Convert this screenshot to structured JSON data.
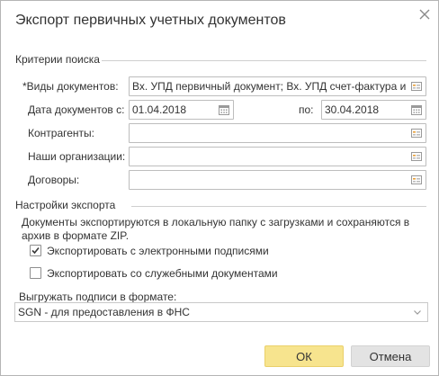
{
  "dialog": {
    "title": "Экспорт первичных учетных документов",
    "close_icon": "close-icon"
  },
  "search": {
    "section_title": "Критерии поиска",
    "doc_types_label": "*Виды документов:",
    "doc_types_value": "Вх. УПД первичный документ; Вх. УПД счет-фактура и первичный документ",
    "date_from_label": "Дата документов с:",
    "date_from_value": "01.04.2018",
    "date_to_label": "по:",
    "date_to_value": "30.04.2018",
    "counterparties_label": "Контрагенты:",
    "counterparties_value": "",
    "organizations_label": "Наши организации:",
    "organizations_value": "",
    "contracts_label": "Договоры:",
    "contracts_value": ""
  },
  "export": {
    "section_title": "Настройки экспорта",
    "info_text": "Документы экспортируются в локальную папку с загрузками и сохраняются в архив в формате ZIP.",
    "with_signatures_label": "Экспортировать с электронными подписями",
    "with_signatures_checked": true,
    "with_service_docs_label": "Экспортировать со служебными документами",
    "with_service_docs_checked": false,
    "format_label": "Выгружать подписи в формате:",
    "format_value": "SGN - для предоставления в ФНС"
  },
  "buttons": {
    "ok_label": "ОК",
    "cancel_label": "Отмена"
  },
  "colors": {
    "ok_button": "#f7e48e",
    "cancel_button": "#e3e3e3",
    "picker_icon": "#e8a03a"
  }
}
